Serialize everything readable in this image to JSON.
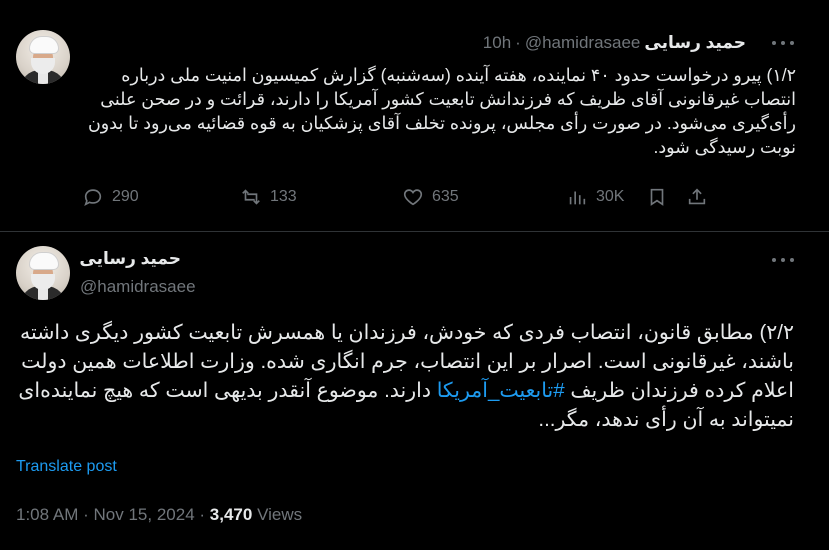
{
  "tweet1": {
    "author_name": "حمید رسایی",
    "handle": "@hamidrasaee",
    "separator": "·",
    "time": "10h",
    "text": "۱/۲) پیرو درخواست حدود ۴۰ نماینده، هفته آینده (سه‌شنبه) گزارش کمیسیون امنیت ملی درباره انتصاب غیرقانونی آقای ظریف که فرزندانش تابعیت کشور آمریکا را دارند، قرائت و در صحن علنی رأی‌گیری می‌شود. در صورت رأی مجلس، پرونده تخلف آقای پزشکیان به قوه قضائیه می‌رود تا بدون نوبت رسیدگی شود.",
    "stats": {
      "replies": "290",
      "reposts": "133",
      "likes": "635",
      "views": "30K"
    }
  },
  "tweet2": {
    "author_name": "حمید رسایی",
    "handle": "@hamidrasaee",
    "text_before_hashtag": "۲/۲) مطابق قانون، انتصاب فردی که خودش، فرزندان یا همسرش تابعیت کشور دیگری داشته باشند، غیرقانونی است. اصرار بر این انتصاب، جرم انگاری شده. وزارت اطلاعات همین دولت اعلام کرده فرزندان ظریف",
    "hashtag": "#تابعیت_آمریکا",
    "text_after_hashtag": "دارند. موضوع آنقدر بدیهی است که هیچ نماینده‌ای نمیتواند به آن رأی ندهد، مگر...",
    "translate_label": "Translate post",
    "timestamp": "1:08 AM",
    "date": "Nov 15, 2024",
    "separator": "·",
    "views_count": "3,470",
    "views_label": "Views"
  },
  "colors": {
    "background": "#000000",
    "text": "#e7e9ea",
    "muted": "#71767b",
    "accent": "#1d9bf0",
    "divider": "#2f3336"
  }
}
